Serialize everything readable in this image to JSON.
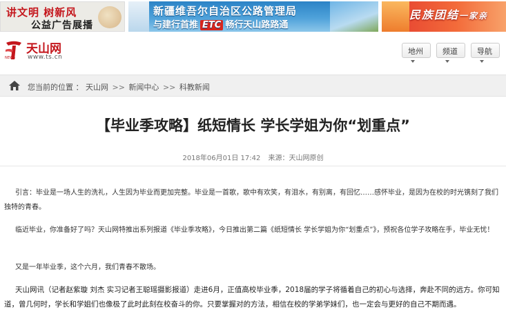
{
  "banners": {
    "b1_line1": "讲文明 树新风",
    "b1_line2": "公益广告展播",
    "b2_line1": "新疆维吾尔自治区公路管理局",
    "b2_line2_pre": "与建行首推",
    "b2_line2_etc": "ETC",
    "b2_line2_post": "畅行天山路路通",
    "b3_main": "民族团结",
    "b3_sub": "一家亲"
  },
  "logo": {
    "name": "天山网",
    "url": "www.ts.cn",
    "mark_text": "NEWS"
  },
  "nav": {
    "region": "地州",
    "channel": "频道",
    "guide": "导航"
  },
  "breadcrumb": {
    "prefix": "您当前的位置 ：",
    "items": [
      "天山网",
      "新闻中心",
      "科教新闻"
    ],
    "sep": ">>"
  },
  "article": {
    "title": "【毕业季攻略】纸短情长 学长学姐为你“划重点”",
    "datetime": "2018年06月01日 17:42",
    "source": "来源：天山网原创",
    "p1": "引言：毕业是一场人生的洗礼，人生因为毕业而更加完整。毕业是一首歌，歌中有欢笑，有泪水，有别离，有回忆……感怀毕业，是因为在校的时光镌刻了我们独特的青春。",
    "p2": "临近毕业，你准备好了吗？天山网特推出系列报道《毕业季攻略》，今日推出第二篇《纸短情长 学长学姐为你“划重点”》，预祝各位学子攻略在手，毕业无忧！",
    "p3": "又是一年毕业季，这个六月，我们青春不散场。",
    "p4": "天山网讯（记者赵紫璇 刘杰 实习记者王聪瑶摄影报道）走进6月，正值高校毕业季，2018届的学子将循着自己的初心与选择，奔赴不同的远方。你可知道，曾几何时，学长和学姐们也像极了此时此刻在校奋斗的你。只要掌握对的方法，相信在校的学弟学妹们，也一定会与更好的自己不期而遇。"
  }
}
